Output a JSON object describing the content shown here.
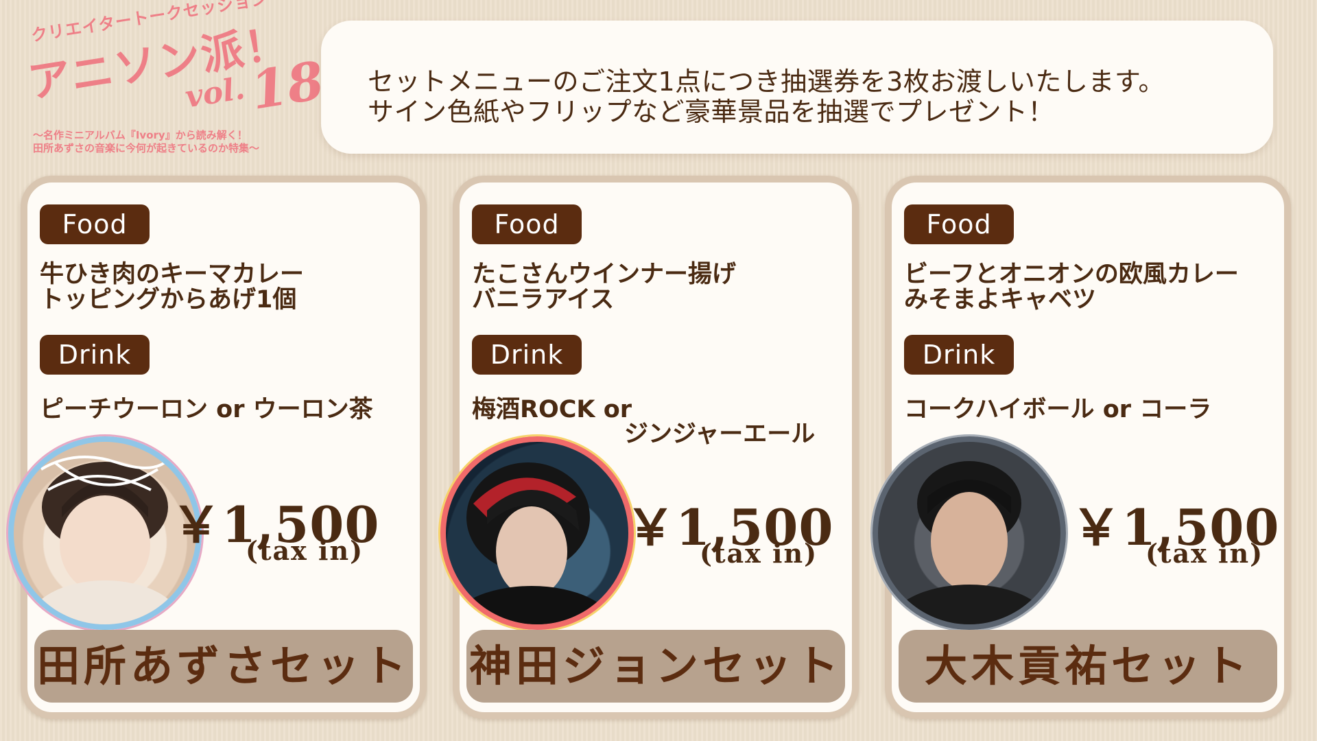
{
  "logo": {
    "subtitle": "クリエイタートークセッション",
    "title": "アニソン派！",
    "vol": "vol.",
    "number": "18",
    "tagline1": "～名作ミニアルバム『Ivory』から読み解く！",
    "tagline2": "田所あずさの音楽に今何が起きているのか特集～"
  },
  "notice": {
    "line1": "セットメニューのご注文1点につき抽選券を3枚お渡しいたします。",
    "line2": "サイン色紙やフリップなど豪華景品を抽選でプレゼント！"
  },
  "cards": [
    {
      "food_label": "Food",
      "food_line1": "牛ひき肉のキーマカレー",
      "food_line2": "トッピングからあげ1個",
      "drink_label": "Drink",
      "drink_line1": "ピーチウーロン or ウーロン茶",
      "drink_line2": "",
      "price": "￥1,500",
      "tax": "(tax in)",
      "set_name": "田所あずさセット"
    },
    {
      "food_label": "Food",
      "food_line1": "たこさんウインナー揚げ",
      "food_line2": "バニラアイス",
      "drink_label": "Drink",
      "drink_line1": "梅酒ROCK or",
      "drink_line2": "ジンジャーエール",
      "price": "￥1,500",
      "tax": "(tax in)",
      "set_name": "神田ジョンセット"
    },
    {
      "food_label": "Food",
      "food_line1": "ビーフとオニオンの欧風カレー",
      "food_line2": "みそまよキャベツ",
      "drink_label": "Drink",
      "drink_line1": "コークハイボール or コーラ",
      "drink_line2": "",
      "price": "￥1,500",
      "tax": "(tax in)",
      "set_name": "大木貢祐セット"
    }
  ]
}
